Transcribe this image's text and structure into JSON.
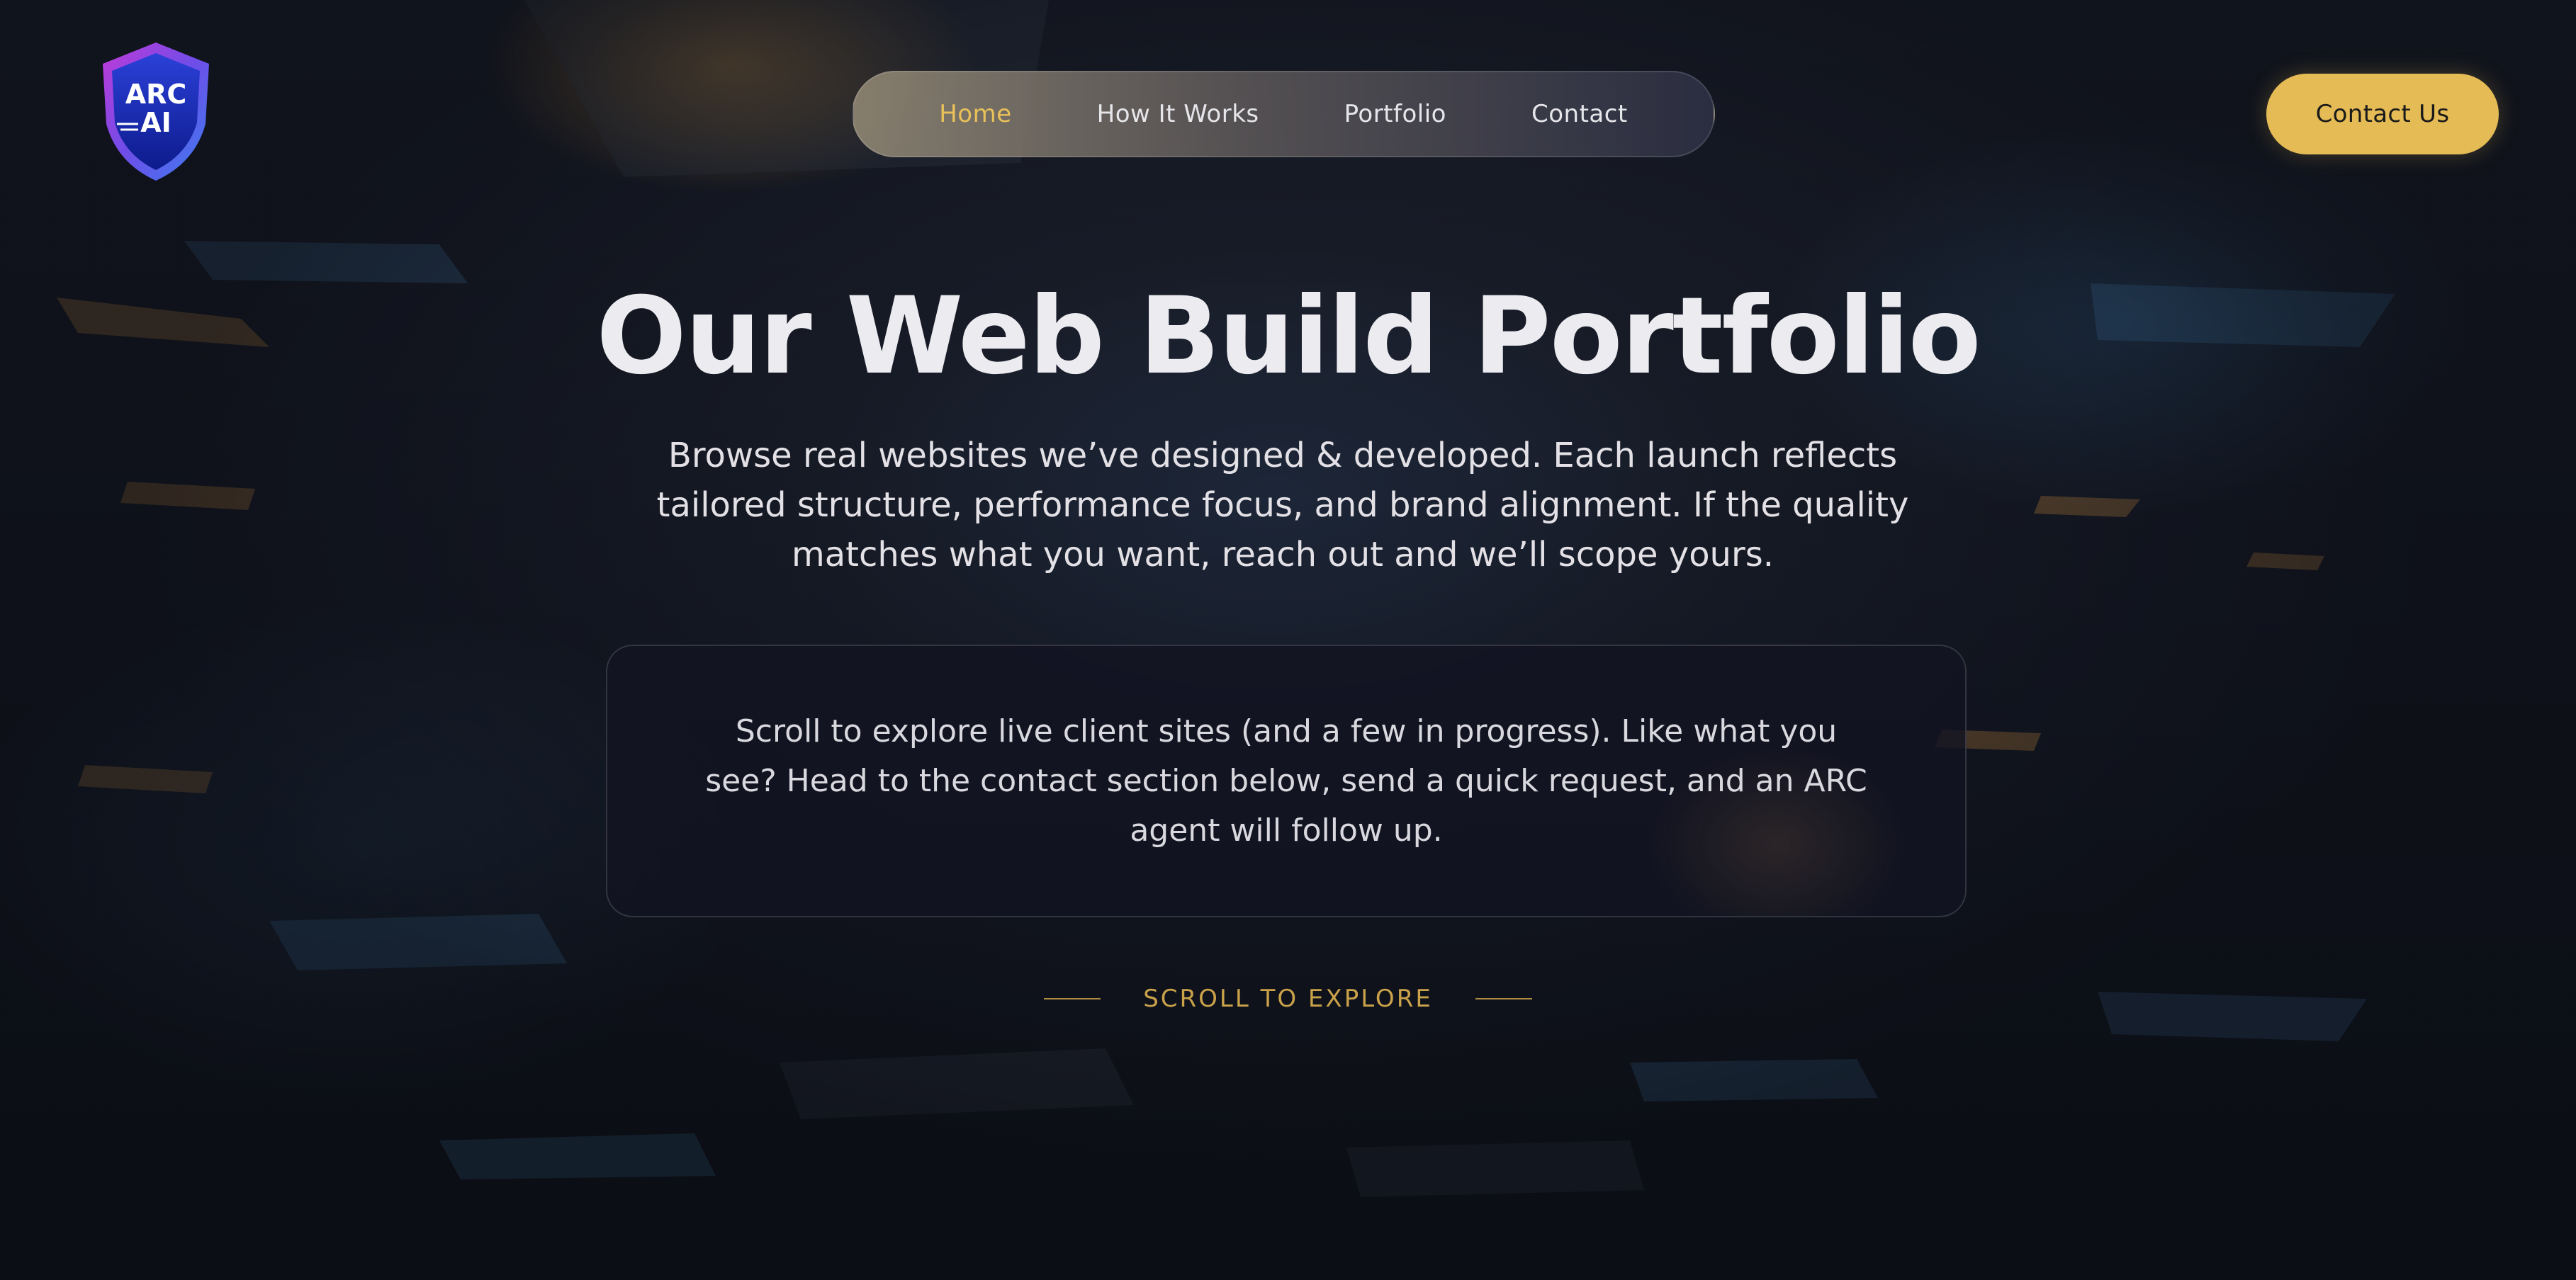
{
  "logo": {
    "line1": "ARC",
    "line2": "AI"
  },
  "nav": {
    "items": [
      {
        "label": "Home",
        "active": true
      },
      {
        "label": "How It Works",
        "active": false
      },
      {
        "label": "Portfolio",
        "active": false
      },
      {
        "label": "Contact",
        "active": false
      }
    ]
  },
  "header": {
    "cta_label": "Contact Us"
  },
  "hero": {
    "title": "Our Web Build Portfolio",
    "subtitle": "Browse real websites we’ve designed & developed. Each launch reflects tailored structure, performance focus, and brand alignment. If the quality matches what you want, reach out and we’ll scope yours."
  },
  "info_card": {
    "text": "Scroll to explore live client sites (and a few in progress). Like what you see? Head to the contact section below, send a quick request, and an ARC agent will follow up."
  },
  "scroll_hint": {
    "label": "SCROLL TO EXPLORE"
  },
  "colors": {
    "accent": "#e5bb56",
    "nav_active": "#e9c15a",
    "background": "#161924"
  }
}
